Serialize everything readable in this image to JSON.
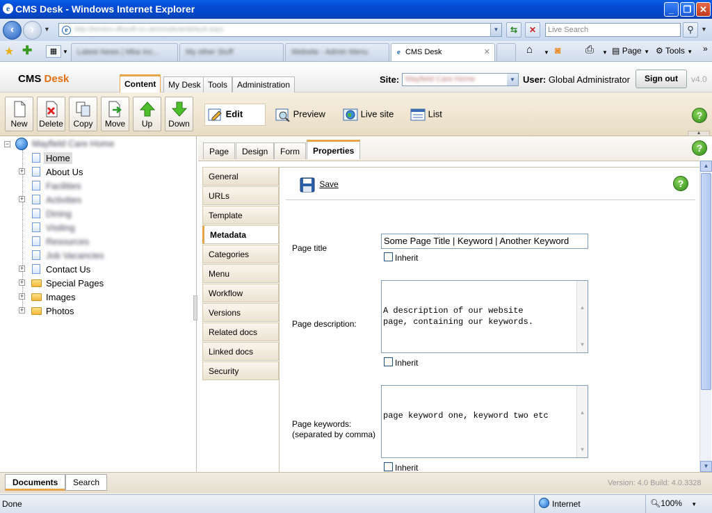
{
  "window": {
    "title": "CMS Desk - Windows Internet Explorer",
    "minimize": "_",
    "restore": "❐",
    "close": "✕"
  },
  "browser": {
    "address_text": "http://kentico.dfssoft.co.uk/cmsdesk/default.aspx",
    "search_placeholder": "Live Search",
    "tabs": [
      "Latest News | Mba Inc...",
      "My other Stuff",
      "Website - Admin Menu",
      "CMS Desk"
    ],
    "tools": {
      "page": "Page",
      "tools": "Tools",
      "more": "»"
    }
  },
  "cms": {
    "logo_cms": "CMS",
    "logo_desk": "Desk",
    "main_tabs": [
      "Content",
      "My Desk",
      "Tools",
      "Administration"
    ],
    "site_label": "Site:",
    "site_value": "Mayfield Care Home",
    "user_label": "User:",
    "user_value": "Global Administrator",
    "signout": "Sign out",
    "version": "v4.0"
  },
  "toolbar": {
    "buttons": [
      "New",
      "Delete",
      "Copy",
      "Move",
      "Up",
      "Down"
    ]
  },
  "modes": {
    "edit": "Edit",
    "preview": "Preview",
    "livesite": "Live site",
    "list": "List"
  },
  "tree": {
    "root": "Mayfield Care Home",
    "items": [
      "Home",
      "About Us",
      "Facilities",
      "Activities",
      "Dining",
      "Visiting",
      "Resources",
      "Job Vacancies",
      "Contact Us",
      "Special Pages",
      "Images",
      "Photos"
    ]
  },
  "page_tabs": [
    "Page",
    "Design",
    "Form",
    "Properties"
  ],
  "prop_menu": [
    "General",
    "URLs",
    "Template",
    "Metadata",
    "Categories",
    "Menu",
    "Workflow",
    "Versions",
    "Related docs",
    "Linked docs",
    "Security"
  ],
  "form": {
    "save": "Save",
    "page_title_label": "Page title",
    "page_title_value": "Some Page Title | Keyword | Another Keyword",
    "inherit": "Inherit",
    "desc_label": "Page description:",
    "desc_value": "A description of our website\npage, containing our keywords.",
    "keywords_label": "Page keywords:",
    "keywords_sub": "(separated by comma)",
    "keywords_value": "page keyword one, keyword two etc"
  },
  "bottom": {
    "tabs": [
      "Documents",
      "Search"
    ],
    "build": "Version: 4.0 Build: 4.0.3328"
  },
  "status": {
    "left": "Done",
    "zone": "Internet",
    "zoom": "100%"
  },
  "colors": {
    "accent": "#e7a44a",
    "titlebar": "#0348d0"
  }
}
